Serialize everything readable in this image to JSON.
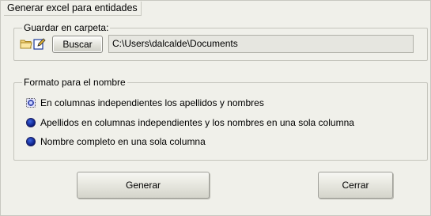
{
  "window": {
    "title": "Generar excel para entidades"
  },
  "folder_group": {
    "legend": "Guardar en carpeta:",
    "browse_button": "Buscar",
    "path_value": "C:\\Users\\dalcalde\\Documents"
  },
  "format_group": {
    "legend": "Formato para el nombre",
    "options": [
      {
        "label": "En columnas independientes los apellidos y nombres",
        "selected": true
      },
      {
        "label": "Apellidos en columnas independientes y los nombres en una sola columna",
        "selected": false
      },
      {
        "label": "Nombre completo en una sola columna",
        "selected": false
      }
    ]
  },
  "actions": {
    "generate": "Generar",
    "close": "Cerrar"
  },
  "icons": [
    "folder-icon",
    "edit-icon"
  ],
  "colors": {
    "background": "#f0f0ea",
    "radio": "#0a1c80"
  }
}
